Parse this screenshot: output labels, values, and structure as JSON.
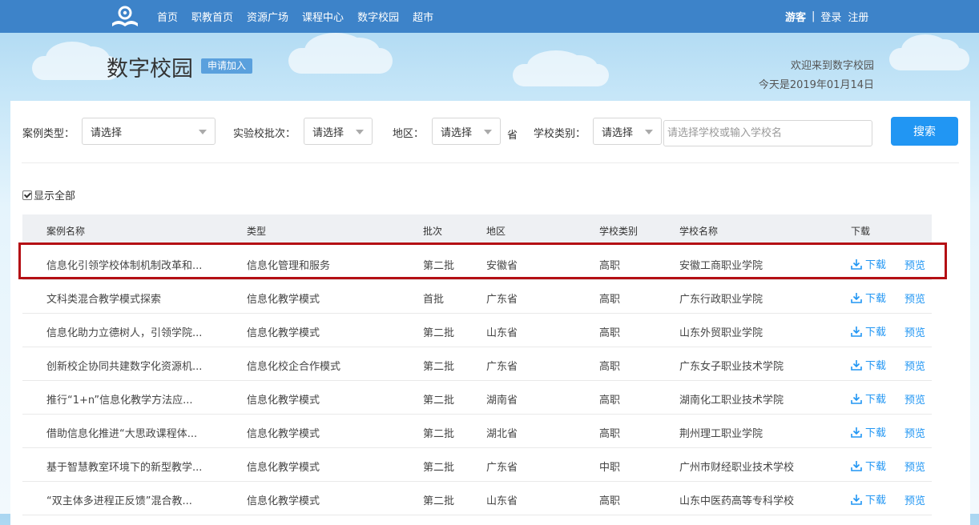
{
  "nav": {
    "items": [
      "首页",
      "职教首页",
      "资源广场",
      "课程中心",
      "数字校园",
      "超市"
    ],
    "guest": "游客",
    "separator": "|",
    "login": "登录",
    "register": "注册"
  },
  "header": {
    "title": "数字校园",
    "apply_label": "申请加入",
    "welcome": "欢迎来到数字校园",
    "today": "今天是2019年01月14日"
  },
  "filters": {
    "case_type_label": "案例类型：",
    "case_type_value": "请选择",
    "batch_label": "实验校批次：",
    "batch_value": "请选择",
    "region_label": "地区：",
    "region_value": "请选择",
    "province_suffix": "省",
    "school_type_label": "学校类别：",
    "school_type_value": "请选择",
    "search_placeholder": "请选择学校或输入学校名",
    "search_label": "搜索"
  },
  "show_all_label": "显示全部",
  "table": {
    "headers": [
      "案例名称",
      "类型",
      "批次",
      "地区",
      "学校类别",
      "学校名称",
      "下载"
    ],
    "download_label": "下载",
    "preview_label": "预览",
    "rows": [
      {
        "name": "信息化引领学校体制机制改革和...",
        "type": "信息化管理和服务",
        "batch": "第二批",
        "region": "安徽省",
        "school_type": "高职",
        "school": "安徽工商职业学院"
      },
      {
        "name": "文科类混合教学模式探索",
        "type": "信息化教学模式",
        "batch": "首批",
        "region": "广东省",
        "school_type": "高职",
        "school": "广东行政职业学院"
      },
      {
        "name": "信息化助力立德树人，引领学院...",
        "type": "信息化教学模式",
        "batch": "第二批",
        "region": "山东省",
        "school_type": "高职",
        "school": "山东外贸职业学院"
      },
      {
        "name": "创新校企协同共建数字化资源机...",
        "type": "信息化校企合作模式",
        "batch": "第二批",
        "region": "广东省",
        "school_type": "高职",
        "school": "广东女子职业技术学院"
      },
      {
        "name": "推行“1+n”信息化教学方法应...",
        "type": "信息化教学模式",
        "batch": "第二批",
        "region": "湖南省",
        "school_type": "高职",
        "school": "湖南化工职业技术学院"
      },
      {
        "name": "借助信息化推进“大思政课程体...",
        "type": "信息化教学模式",
        "batch": "第二批",
        "region": "湖北省",
        "school_type": "高职",
        "school": "荆州理工职业学院"
      },
      {
        "name": "基于智慧教室环境下的新型教学...",
        "type": "信息化教学模式",
        "batch": "第二批",
        "region": "广东省",
        "school_type": "中职",
        "school": "广州市财经职业技术学校"
      },
      {
        "name": "“双主体多进程正反馈”混合教...",
        "type": "信息化教学模式",
        "batch": "第二批",
        "region": "山东省",
        "school_type": "高职",
        "school": "山东中医药高等专科学校"
      }
    ]
  }
}
